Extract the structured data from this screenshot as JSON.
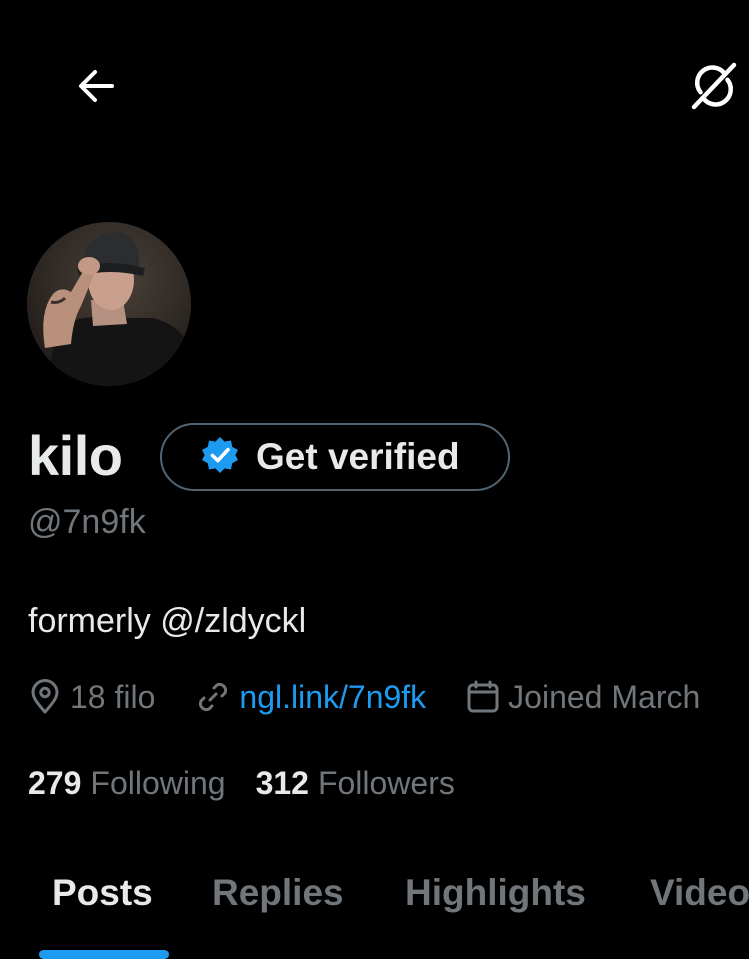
{
  "header": {
    "back_icon": "arrow-left-icon",
    "grok_icon": "grok-icon"
  },
  "profile": {
    "display_name": "kilo",
    "handle": "@7n9fk",
    "bio": "formerly @/zldyckl",
    "avatar_icon": "profile-photo",
    "verify_button": {
      "label": "Get verified",
      "icon": "verified-badge-icon",
      "badge_color": "#1d9bf0"
    },
    "meta": {
      "location": "18 filo",
      "location_icon": "location-pin-icon",
      "link": "ngl.link/7n9fk",
      "link_icon": "link-icon",
      "joined": "Joined March",
      "joined_icon": "calendar-icon"
    },
    "stats": {
      "following_count": "279",
      "following_label": "Following",
      "followers_count": "312",
      "followers_label": "Followers"
    }
  },
  "tabs": [
    {
      "label": "Posts",
      "active": true
    },
    {
      "label": "Replies",
      "active": false
    },
    {
      "label": "Highlights",
      "active": false
    },
    {
      "label": "Videos",
      "active": false
    }
  ],
  "colors": {
    "background": "#000000",
    "text_primary": "#e7e9ea",
    "text_secondary": "#71767b",
    "accent": "#1d9bf0",
    "border": "#536471"
  }
}
